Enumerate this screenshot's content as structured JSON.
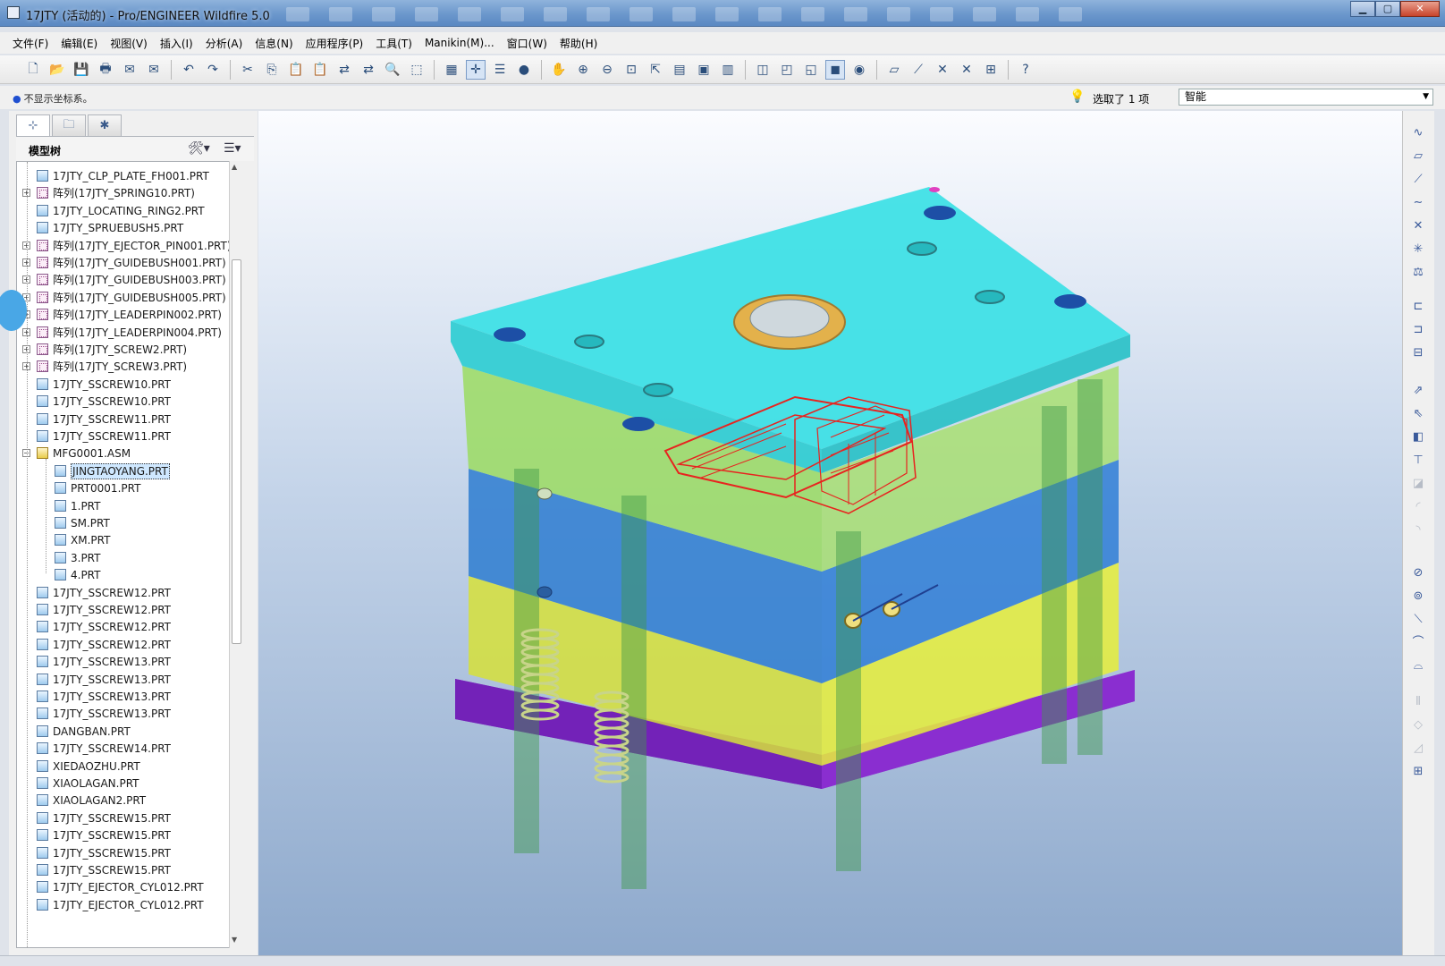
{
  "window": {
    "title": "17JTY (活动的) - Pro/ENGINEER Wildfire 5.0",
    "minimize": "▁",
    "maximize": "▢",
    "close": "✕"
  },
  "menu": [
    "文件(F)",
    "编辑(E)",
    "视图(V)",
    "插入(I)",
    "分析(A)",
    "信息(N)",
    "应用程序(P)",
    "工具(T)",
    "Manikin(M)...",
    "窗口(W)",
    "帮助(H)"
  ],
  "status": {
    "message": "不显示坐标系。",
    "selection": "选取了 1 项",
    "filter": "智能"
  },
  "model_tree": {
    "label": "模型树",
    "rows": [
      {
        "text": "17JTY_CLP_PLATE_FH001.PRT",
        "type": "part",
        "expand": false,
        "level": 0
      },
      {
        "text": "阵列(17JTY_SPRING10.PRT)",
        "type": "pattern",
        "expand": true,
        "level": 0
      },
      {
        "text": "17JTY_LOCATING_RING2.PRT",
        "type": "part",
        "expand": false,
        "level": 0
      },
      {
        "text": "17JTY_SPRUEBUSH5.PRT",
        "type": "part",
        "expand": false,
        "level": 0
      },
      {
        "text": "阵列(17JTY_EJECTOR_PIN001.PRT)",
        "type": "pattern",
        "expand": true,
        "level": 0
      },
      {
        "text": "阵列(17JTY_GUIDEBUSH001.PRT)",
        "type": "pattern",
        "expand": true,
        "level": 0
      },
      {
        "text": "阵列(17JTY_GUIDEBUSH003.PRT)",
        "type": "pattern",
        "expand": true,
        "level": 0
      },
      {
        "text": "阵列(17JTY_GUIDEBUSH005.PRT)",
        "type": "pattern",
        "expand": true,
        "level": 0
      },
      {
        "text": "阵列(17JTY_LEADERPIN002.PRT)",
        "type": "pattern",
        "expand": true,
        "level": 0
      },
      {
        "text": "阵列(17JTY_LEADERPIN004.PRT)",
        "type": "pattern",
        "expand": true,
        "level": 0
      },
      {
        "text": "阵列(17JTY_SCREW2.PRT)",
        "type": "pattern",
        "expand": true,
        "level": 0
      },
      {
        "text": "阵列(17JTY_SCREW3.PRT)",
        "type": "pattern",
        "expand": true,
        "level": 0
      },
      {
        "text": "17JTY_SSCREW10.PRT",
        "type": "part",
        "expand": false,
        "level": 0
      },
      {
        "text": "17JTY_SSCREW10.PRT",
        "type": "part",
        "expand": false,
        "level": 0
      },
      {
        "text": "17JTY_SSCREW11.PRT",
        "type": "part",
        "expand": false,
        "level": 0
      },
      {
        "text": "17JTY_SSCREW11.PRT",
        "type": "part",
        "expand": false,
        "level": 0
      },
      {
        "text": "MFG0001.ASM",
        "type": "asm",
        "expand": "open",
        "level": 0
      },
      {
        "text": "JINGTAOYANG.PRT",
        "type": "part",
        "expand": false,
        "level": 1,
        "selected": true
      },
      {
        "text": "PRT0001.PRT",
        "type": "part",
        "expand": false,
        "level": 1
      },
      {
        "text": "1.PRT",
        "type": "part",
        "expand": false,
        "level": 1
      },
      {
        "text": "SM.PRT",
        "type": "part",
        "expand": false,
        "level": 1
      },
      {
        "text": "XM.PRT",
        "type": "part",
        "expand": false,
        "level": 1
      },
      {
        "text": "3.PRT",
        "type": "part",
        "expand": false,
        "level": 1
      },
      {
        "text": "4.PRT",
        "type": "part",
        "expand": false,
        "level": 1
      },
      {
        "text": "17JTY_SSCREW12.PRT",
        "type": "part",
        "expand": false,
        "level": 0
      },
      {
        "text": "17JTY_SSCREW12.PRT",
        "type": "part",
        "expand": false,
        "level": 0
      },
      {
        "text": "17JTY_SSCREW12.PRT",
        "type": "part",
        "expand": false,
        "level": 0
      },
      {
        "text": "17JTY_SSCREW12.PRT",
        "type": "part",
        "expand": false,
        "level": 0
      },
      {
        "text": "17JTY_SSCREW13.PRT",
        "type": "part",
        "expand": false,
        "level": 0
      },
      {
        "text": "17JTY_SSCREW13.PRT",
        "type": "part",
        "expand": false,
        "level": 0
      },
      {
        "text": "17JTY_SSCREW13.PRT",
        "type": "part",
        "expand": false,
        "level": 0
      },
      {
        "text": "17JTY_SSCREW13.PRT",
        "type": "part",
        "expand": false,
        "level": 0
      },
      {
        "text": "DANGBAN.PRT",
        "type": "part",
        "expand": false,
        "level": 0
      },
      {
        "text": "17JTY_SSCREW14.PRT",
        "type": "part",
        "expand": false,
        "level": 0
      },
      {
        "text": "XIEDAOZHU.PRT",
        "type": "part",
        "expand": false,
        "level": 0
      },
      {
        "text": "XIAOLAGAN.PRT",
        "type": "part",
        "expand": false,
        "level": 0
      },
      {
        "text": "XIAOLAGAN2.PRT",
        "type": "part",
        "expand": false,
        "level": 0
      },
      {
        "text": "17JTY_SSCREW15.PRT",
        "type": "part",
        "expand": false,
        "level": 0
      },
      {
        "text": "17JTY_SSCREW15.PRT",
        "type": "part",
        "expand": false,
        "level": 0
      },
      {
        "text": "17JTY_SSCREW15.PRT",
        "type": "part",
        "expand": false,
        "level": 0
      },
      {
        "text": "17JTY_SSCREW15.PRT",
        "type": "part",
        "expand": false,
        "level": 0
      },
      {
        "text": "17JTY_EJECTOR_CYL012.PRT",
        "type": "part",
        "expand": false,
        "level": 0
      },
      {
        "text": "17JTY_EJECTOR_CYL012.PRT",
        "type": "part",
        "expand": false,
        "level": 0
      }
    ]
  },
  "toolbar_icons": [
    "new-icon",
    "open-icon",
    "save-icon",
    "print-icon",
    "email-icon",
    "email-link-icon",
    "sep",
    "undo-icon",
    "redo-icon",
    "sep",
    "cut-icon",
    "copy-icon",
    "paste-icon",
    "paste-special-icon",
    "regenerate-icon",
    "regenerate-manager-icon",
    "find-icon",
    "select-box-icon",
    "sep",
    "datum-display-icon",
    "spin-center-icon",
    "layers-icon",
    "shading-icon",
    "sep",
    "pan-icon",
    "zoom-in-icon",
    "zoom-out-icon",
    "refit-icon",
    "reorient-icon",
    "saved-views-icon",
    "view-manager-icon",
    "appearance-icon",
    "sep",
    "wireframe-icon",
    "hidden-line-icon",
    "no-hidden-icon",
    "shaded-icon",
    "enhanced-realism-icon",
    "sep",
    "datum-planes-icon",
    "datum-axes-icon",
    "datum-points-icon",
    "coordinate-systems-icon",
    "annotation-icon",
    "sep",
    "help-icon"
  ],
  "toolbar_glyphs": {
    "new-icon": "🗋",
    "open-icon": "📂",
    "save-icon": "💾",
    "print-icon": "🖶",
    "email-icon": "✉",
    "email-link-icon": "✉",
    "undo-icon": "↶",
    "redo-icon": "↷",
    "cut-icon": "✂",
    "copy-icon": "⎘",
    "paste-icon": "📋",
    "paste-special-icon": "📋",
    "regenerate-icon": "⇄",
    "regenerate-manager-icon": "⇄",
    "find-icon": "🔍",
    "select-box-icon": "⬚",
    "datum-display-icon": "▦",
    "spin-center-icon": "✛",
    "layers-icon": "☰",
    "shading-icon": "●",
    "pan-icon": "✋",
    "zoom-in-icon": "⊕",
    "zoom-out-icon": "⊖",
    "refit-icon": "⊡",
    "reorient-icon": "⇱",
    "saved-views-icon": "▤",
    "view-manager-icon": "▣",
    "appearance-icon": "▥",
    "wireframe-icon": "◫",
    "hidden-line-icon": "◰",
    "no-hidden-icon": "◱",
    "shaded-icon": "◼",
    "enhanced-realism-icon": "◉",
    "datum-planes-icon": "▱",
    "datum-axes-icon": "⟋",
    "datum-points-icon": "✕",
    "coordinate-systems-icon": "✕",
    "annotation-icon": "⊞",
    "help-icon": "?"
  },
  "right_toolbar": [
    {
      "name": "sketch-icon",
      "glyph": "∿",
      "disabled": false
    },
    {
      "name": "plane-icon",
      "glyph": "▱",
      "disabled": false
    },
    {
      "name": "axis-icon",
      "glyph": "⟋",
      "disabled": false
    },
    {
      "name": "curve-icon",
      "glyph": "∼",
      "disabled": false
    },
    {
      "name": "point-icon",
      "glyph": "✕",
      "disabled": false
    },
    {
      "name": "csys-icon",
      "glyph": "✳",
      "disabled": false
    },
    {
      "name": "analysis-icon",
      "glyph": "⚖",
      "disabled": false
    },
    {
      "name": "insert-component-icon",
      "glyph": "⊏",
      "disabled": false
    },
    {
      "name": "create-component-icon",
      "glyph": "⊐",
      "disabled": false
    },
    {
      "name": "repeat-icon",
      "glyph": "⊟",
      "disabled": false
    },
    {
      "name": "mold-icon",
      "glyph": "⇗",
      "disabled": false
    },
    {
      "name": "cavity-icon",
      "glyph": "⇖",
      "disabled": false
    },
    {
      "name": "split-icon",
      "glyph": "◧",
      "disabled": false
    },
    {
      "name": "shaft-icon",
      "glyph": "⊤",
      "disabled": false
    },
    {
      "name": "cut-feature-icon",
      "glyph": "◪",
      "disabled": true
    },
    {
      "name": "round-icon",
      "glyph": "◜",
      "disabled": true
    },
    {
      "name": "chamfer-icon",
      "glyph": "◝",
      "disabled": true
    },
    {
      "name": "hole-icon",
      "glyph": "⊘",
      "disabled": false
    },
    {
      "name": "shell-icon",
      "glyph": "⊚",
      "disabled": false
    },
    {
      "name": "rib-icon",
      "glyph": "⟍",
      "disabled": false
    },
    {
      "name": "draft-icon",
      "glyph": "⌒",
      "disabled": false
    },
    {
      "name": "surface-icon",
      "glyph": "⌓",
      "disabled": false
    },
    {
      "name": "mirror-icon",
      "glyph": "⫴",
      "disabled": true
    },
    {
      "name": "merge-icon",
      "glyph": "◇",
      "disabled": true
    },
    {
      "name": "trim-icon",
      "glyph": "◿",
      "disabled": true
    },
    {
      "name": "pattern-icon",
      "glyph": "⊞",
      "disabled": false
    }
  ],
  "colors": {
    "top_plate": "#3fe0e6",
    "a_plate": "#a6e06a",
    "b_plate": "#2f7ed6",
    "support_plate": "#d6e03a",
    "base_plate": "#8a2ed0",
    "part_wire": "#e8231f",
    "locating_ring": "#e3b14b"
  }
}
